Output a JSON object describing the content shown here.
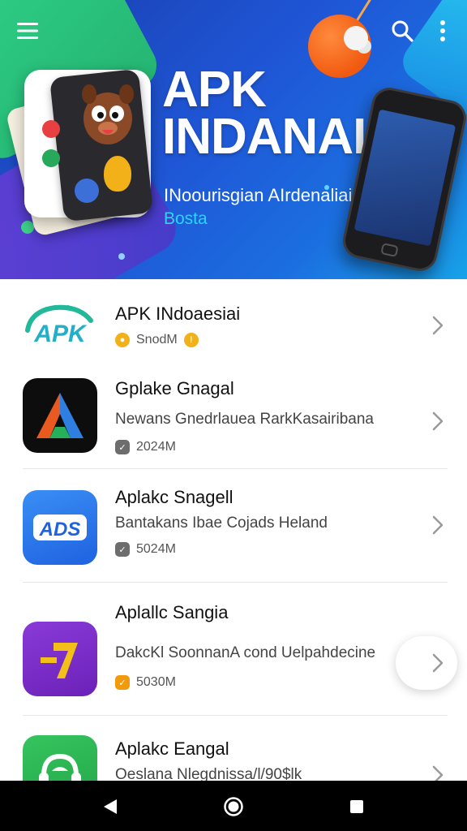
{
  "hero": {
    "title_line1": "APK",
    "title_line2": "INDANAIA",
    "subtitle": "INoourisgian AIrdenaliairtu",
    "beta": "Bosta"
  },
  "toolbar": {
    "menu_icon": "hamburger-menu-icon",
    "search_icon": "search-icon",
    "more_icon": "more-vert-icon"
  },
  "apps": [
    {
      "title": "APK INdoaesiai",
      "desc": "",
      "meta": "SnodМ",
      "badge_color": "#f2b019",
      "icon": "apk-logo-icon"
    },
    {
      "title": "Gplake Gnagal",
      "desc": "Newans Gnedrlauea RarkΚasairibana",
      "meta": "2024M",
      "badge_color": "#6d6d6d",
      "icon": "triangle-a-icon"
    },
    {
      "title": "Aplakc Snagell",
      "desc": "Bantakans Ibae Cojads Heland",
      "meta": "5024M",
      "badge_color": "#6d6d6d",
      "icon": "ads-icon"
    },
    {
      "title": "Aplallc Sangia",
      "desc": "DakcKl SoonnanA cond Uelpahdecine",
      "meta": "5030M",
      "badge_color": "#f29a0a",
      "icon": "seven-icon"
    },
    {
      "title": "Aplakc Eangal",
      "desc": "Oeslana Nlegdnissa/l/90$lk",
      "meta": "",
      "badge_color": "#6d6d6d",
      "icon": "android-headphones-icon"
    }
  ],
  "colors": {
    "hero_bg": "#1f56d6",
    "accent_cyan": "#27d7ff",
    "chevron": "#9a9a9a"
  },
  "navbar": {
    "back_icon": "nav-back-icon",
    "home_icon": "nav-home-icon",
    "recent_icon": "nav-recent-icon"
  }
}
